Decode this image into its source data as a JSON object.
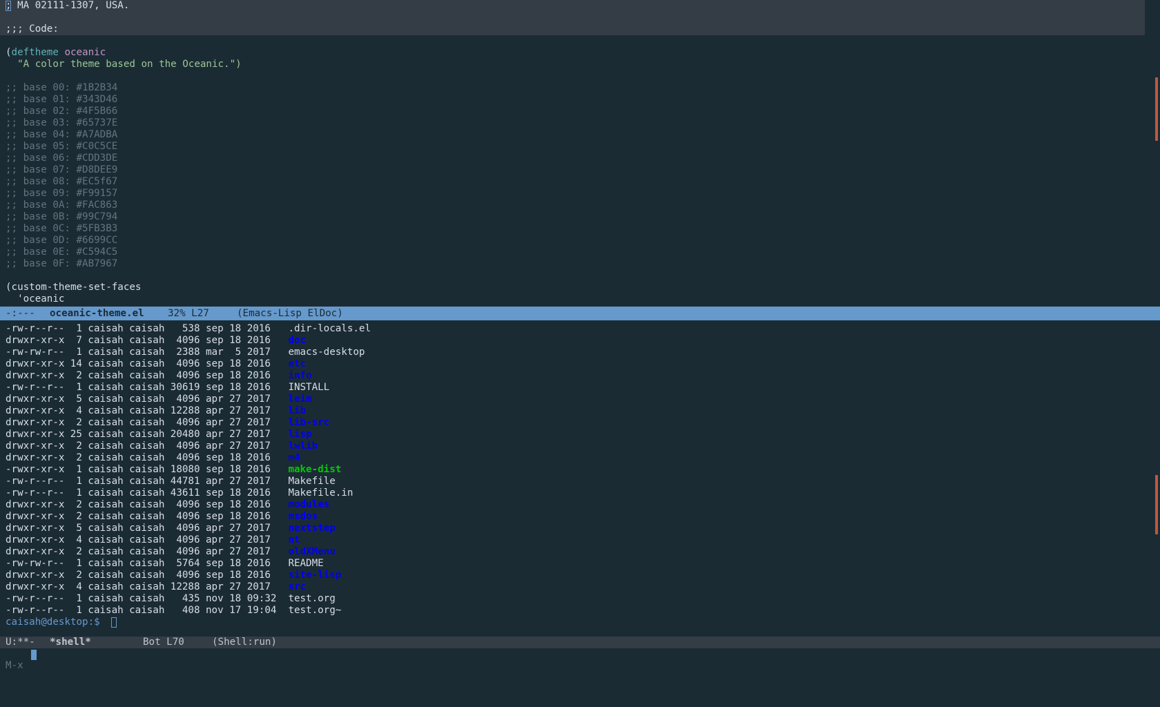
{
  "top_buffer": {
    "lines": [
      {
        "parts": [
          {
            "t": "; MA 02111-1307, USA.",
            "c": "plain"
          }
        ],
        "cursor_before": true
      },
      {
        "parts": [
          {
            "t": "",
            "c": "plain"
          }
        ]
      },
      {
        "parts": [
          {
            "t": ";;; Code:",
            "c": "plain"
          }
        ]
      },
      {
        "parts": [
          {
            "t": "",
            "c": "plain"
          }
        ]
      },
      {
        "parts": [
          {
            "t": "(",
            "c": "paren"
          },
          {
            "t": "deftheme",
            "c": "kw"
          },
          {
            "t": " ",
            "c": "plain"
          },
          {
            "t": "oceanic",
            "c": "fname"
          }
        ]
      },
      {
        "parts": [
          {
            "t": "  \"A color theme based on the Oceanic.\")",
            "c": "str"
          }
        ]
      },
      {
        "parts": [
          {
            "t": "",
            "c": "plain"
          }
        ]
      },
      {
        "parts": [
          {
            "t": ";; base 00: #1B2B34",
            "c": "comment"
          }
        ]
      },
      {
        "parts": [
          {
            "t": ";; base 01: #343D46",
            "c": "comment"
          }
        ]
      },
      {
        "parts": [
          {
            "t": ";; base 02: #4F5B66",
            "c": "comment"
          }
        ]
      },
      {
        "parts": [
          {
            "t": ";; base 03: #65737E",
            "c": "comment"
          }
        ]
      },
      {
        "parts": [
          {
            "t": ";; base 04: #A7ADBA",
            "c": "comment"
          }
        ]
      },
      {
        "parts": [
          {
            "t": ";; base 05: #C0C5CE",
            "c": "comment"
          }
        ]
      },
      {
        "parts": [
          {
            "t": ";; base 06: #CDD3DE",
            "c": "comment"
          }
        ]
      },
      {
        "parts": [
          {
            "t": ";; base 07: #D8DEE9",
            "c": "comment"
          }
        ]
      },
      {
        "parts": [
          {
            "t": ";; base 08: #EC5f67",
            "c": "comment"
          }
        ]
      },
      {
        "parts": [
          {
            "t": ";; base 09: #F99157",
            "c": "comment"
          }
        ]
      },
      {
        "parts": [
          {
            "t": ";; base 0A: #FAC863",
            "c": "comment"
          }
        ]
      },
      {
        "parts": [
          {
            "t": ";; base 0B: #99C794",
            "c": "comment"
          }
        ]
      },
      {
        "parts": [
          {
            "t": ";; base 0C: #5FB3B3",
            "c": "comment"
          }
        ]
      },
      {
        "parts": [
          {
            "t": ";; base 0D: #6699CC",
            "c": "comment"
          }
        ]
      },
      {
        "parts": [
          {
            "t": ";; base 0E: #C594C5",
            "c": "comment"
          }
        ]
      },
      {
        "parts": [
          {
            "t": ";; base 0F: #AB7967",
            "c": "comment"
          }
        ]
      },
      {
        "parts": [
          {
            "t": "",
            "c": "plain"
          }
        ]
      },
      {
        "parts": [
          {
            "t": "(custom-theme-set-faces",
            "c": "plain"
          }
        ]
      },
      {
        "parts": [
          {
            "t": "  'oceanic",
            "c": "plain"
          }
        ]
      }
    ]
  },
  "top_mode_line": {
    "status": "-:---",
    "buffer_name": "oceanic-theme.el",
    "position": "32% L27",
    "modes": "(Emacs-Lisp ElDoc)"
  },
  "listing": [
    {
      "perms": "-rw-r--r--",
      "links": "1",
      "owner": "caisah",
      "group": "caisah",
      "size": "538",
      "month": "sep",
      "day": "18",
      "time": "2016",
      "name": ".dir-locals.el",
      "kind": "file"
    },
    {
      "perms": "drwxr-xr-x",
      "links": "7",
      "owner": "caisah",
      "group": "caisah",
      "size": "4096",
      "month": "sep",
      "day": "18",
      "time": "2016",
      "name": "doc",
      "kind": "dir"
    },
    {
      "perms": "-rw-rw-r--",
      "links": "1",
      "owner": "caisah",
      "group": "caisah",
      "size": "2388",
      "month": "mar",
      "day": "5",
      "time": "2017",
      "name": "emacs-desktop",
      "kind": "file"
    },
    {
      "perms": "drwxr-xr-x",
      "links": "14",
      "owner": "caisah",
      "group": "caisah",
      "size": "4096",
      "month": "sep",
      "day": "18",
      "time": "2016",
      "name": "etc",
      "kind": "dir"
    },
    {
      "perms": "drwxr-xr-x",
      "links": "2",
      "owner": "caisah",
      "group": "caisah",
      "size": "4096",
      "month": "sep",
      "day": "18",
      "time": "2016",
      "name": "info",
      "kind": "dir"
    },
    {
      "perms": "-rw-r--r--",
      "links": "1",
      "owner": "caisah",
      "group": "caisah",
      "size": "30619",
      "month": "sep",
      "day": "18",
      "time": "2016",
      "name": "INSTALL",
      "kind": "file"
    },
    {
      "perms": "drwxr-xr-x",
      "links": "5",
      "owner": "caisah",
      "group": "caisah",
      "size": "4096",
      "month": "apr",
      "day": "27",
      "time": "2017",
      "name": "leim",
      "kind": "dir"
    },
    {
      "perms": "drwxr-xr-x",
      "links": "4",
      "owner": "caisah",
      "group": "caisah",
      "size": "12288",
      "month": "apr",
      "day": "27",
      "time": "2017",
      "name": "lib",
      "kind": "dir"
    },
    {
      "perms": "drwxr-xr-x",
      "links": "2",
      "owner": "caisah",
      "group": "caisah",
      "size": "4096",
      "month": "apr",
      "day": "27",
      "time": "2017",
      "name": "lib-src",
      "kind": "dir"
    },
    {
      "perms": "drwxr-xr-x",
      "links": "25",
      "owner": "caisah",
      "group": "caisah",
      "size": "20480",
      "month": "apr",
      "day": "27",
      "time": "2017",
      "name": "lisp",
      "kind": "dir"
    },
    {
      "perms": "drwxr-xr-x",
      "links": "2",
      "owner": "caisah",
      "group": "caisah",
      "size": "4096",
      "month": "apr",
      "day": "27",
      "time": "2017",
      "name": "lwlib",
      "kind": "dir"
    },
    {
      "perms": "drwxr-xr-x",
      "links": "2",
      "owner": "caisah",
      "group": "caisah",
      "size": "4096",
      "month": "sep",
      "day": "18",
      "time": "2016",
      "name": "m4",
      "kind": "dir"
    },
    {
      "perms": "-rwxr-xr-x",
      "links": "1",
      "owner": "caisah",
      "group": "caisah",
      "size": "18080",
      "month": "sep",
      "day": "18",
      "time": "2016",
      "name": "make-dist",
      "kind": "exe"
    },
    {
      "perms": "-rw-r--r--",
      "links": "1",
      "owner": "caisah",
      "group": "caisah",
      "size": "44781",
      "month": "apr",
      "day": "27",
      "time": "2017",
      "name": "Makefile",
      "kind": "file"
    },
    {
      "perms": "-rw-r--r--",
      "links": "1",
      "owner": "caisah",
      "group": "caisah",
      "size": "43611",
      "month": "sep",
      "day": "18",
      "time": "2016",
      "name": "Makefile.in",
      "kind": "file"
    },
    {
      "perms": "drwxr-xr-x",
      "links": "2",
      "owner": "caisah",
      "group": "caisah",
      "size": "4096",
      "month": "sep",
      "day": "18",
      "time": "2016",
      "name": "modules",
      "kind": "dir"
    },
    {
      "perms": "drwxr-xr-x",
      "links": "2",
      "owner": "caisah",
      "group": "caisah",
      "size": "4096",
      "month": "sep",
      "day": "18",
      "time": "2016",
      "name": "msdos",
      "kind": "dir"
    },
    {
      "perms": "drwxr-xr-x",
      "links": "5",
      "owner": "caisah",
      "group": "caisah",
      "size": "4096",
      "month": "apr",
      "day": "27",
      "time": "2017",
      "name": "nextstep",
      "kind": "dir"
    },
    {
      "perms": "drwxr-xr-x",
      "links": "4",
      "owner": "caisah",
      "group": "caisah",
      "size": "4096",
      "month": "apr",
      "day": "27",
      "time": "2017",
      "name": "nt",
      "kind": "dir"
    },
    {
      "perms": "drwxr-xr-x",
      "links": "2",
      "owner": "caisah",
      "group": "caisah",
      "size": "4096",
      "month": "apr",
      "day": "27",
      "time": "2017",
      "name": "oldXMenu",
      "kind": "dir"
    },
    {
      "perms": "-rw-rw-r--",
      "links": "1",
      "owner": "caisah",
      "group": "caisah",
      "size": "5764",
      "month": "sep",
      "day": "18",
      "time": "2016",
      "name": "README",
      "kind": "file"
    },
    {
      "perms": "drwxr-xr-x",
      "links": "2",
      "owner": "caisah",
      "group": "caisah",
      "size": "4096",
      "month": "sep",
      "day": "18",
      "time": "2016",
      "name": "site-lisp",
      "kind": "dir"
    },
    {
      "perms": "drwxr-xr-x",
      "links": "4",
      "owner": "caisah",
      "group": "caisah",
      "size": "12288",
      "month": "apr",
      "day": "27",
      "time": "2017",
      "name": "src",
      "kind": "dir"
    },
    {
      "perms": "-rw-r--r--",
      "links": "1",
      "owner": "caisah",
      "group": "caisah",
      "size": "435",
      "month": "nov",
      "day": "18",
      "time": "09:32",
      "name": "test.org",
      "kind": "file"
    },
    {
      "perms": "-rw-r--r--",
      "links": "1",
      "owner": "caisah",
      "group": "caisah",
      "size": "408",
      "month": "nov",
      "day": "17",
      "time": "19:04",
      "name": "test.org~",
      "kind": "file"
    }
  ],
  "shell": {
    "prompt": "caisah@desktop:$ "
  },
  "bottom_mode_line": {
    "status": "U:**-",
    "buffer_name": "*shell*",
    "position": "Bot L70",
    "modes": "(Shell:run)"
  },
  "minibuffer": {
    "label": "M-x"
  },
  "colors": {
    "background": "#1b2b34",
    "highlight": "#343d46",
    "active_mode_line": "#6699cc",
    "directory": "#0000ee",
    "executable": "#00cd00",
    "scroll_indicator": "#c0583a"
  }
}
